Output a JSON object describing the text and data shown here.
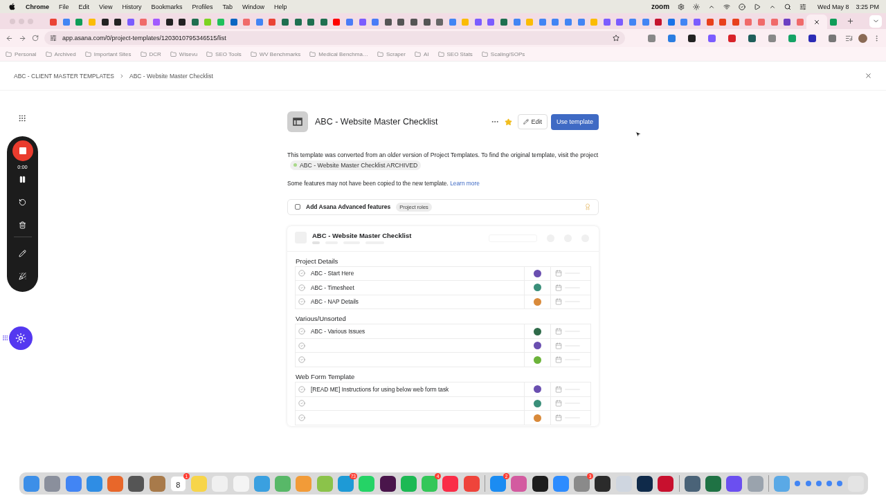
{
  "menubar": {
    "app": "Chrome",
    "menus": [
      "File",
      "Edit",
      "View",
      "History",
      "Bookmarks",
      "Profiles",
      "Tab",
      "Window",
      "Help"
    ],
    "zoom_label": "zoom",
    "date": "Wed May 8",
    "time": "3:25 PM"
  },
  "tabs": [
    {
      "color": "#ea4335",
      "selected": false
    },
    {
      "color": "#4285f4",
      "selected": false
    },
    {
      "color": "#0f9d58",
      "selected": false
    },
    {
      "color": "#fbbc04",
      "selected": false
    },
    {
      "color": "#222222",
      "selected": false
    },
    {
      "color": "#222222",
      "selected": false
    },
    {
      "color": "#7b5cff",
      "selected": false
    },
    {
      "color": "#f06a6a",
      "selected": false
    },
    {
      "color": "#a259ff",
      "selected": false
    },
    {
      "color": "#222222",
      "selected": false
    },
    {
      "color": "#222222",
      "selected": false
    },
    {
      "color": "#1f6f50",
      "selected": false
    },
    {
      "color": "#7dd321",
      "selected": false
    },
    {
      "color": "#20c05c",
      "selected": false
    },
    {
      "color": "#0a66c2",
      "selected": false
    },
    {
      "color": "#f06a6a",
      "selected": false
    },
    {
      "color": "#4285f4",
      "selected": false
    },
    {
      "color": "#ea4335",
      "selected": false
    },
    {
      "color": "#1f6f50",
      "selected": false
    },
    {
      "color": "#1f6f50",
      "selected": false
    },
    {
      "color": "#1f6f50",
      "selected": false
    },
    {
      "color": "#1f6f50",
      "selected": false
    },
    {
      "color": "#ff0000",
      "selected": false
    },
    {
      "color": "#4a7cf7",
      "selected": false
    },
    {
      "color": "#7b5cff",
      "selected": false
    },
    {
      "color": "#4a7cf7",
      "selected": false
    },
    {
      "color": "#555555",
      "selected": false
    },
    {
      "color": "#555555",
      "selected": false
    },
    {
      "color": "#555555",
      "selected": false
    },
    {
      "color": "#555555",
      "selected": false
    },
    {
      "color": "#666666",
      "selected": false
    },
    {
      "color": "#4285f4",
      "selected": false
    },
    {
      "color": "#fbbc04",
      "selected": false
    },
    {
      "color": "#7b5cff",
      "selected": false
    },
    {
      "color": "#7b5cff",
      "selected": false
    },
    {
      "color": "#1f6f50",
      "selected": false
    },
    {
      "color": "#4285f4",
      "selected": false
    },
    {
      "color": "#fbbc04",
      "selected": false
    },
    {
      "color": "#4285f4",
      "selected": false
    },
    {
      "color": "#4285f4",
      "selected": false
    },
    {
      "color": "#4285f4",
      "selected": false
    },
    {
      "color": "#4285f4",
      "selected": false
    },
    {
      "color": "#fbbc04",
      "selected": false
    },
    {
      "color": "#7b5cff",
      "selected": false
    },
    {
      "color": "#7b5cff",
      "selected": false
    },
    {
      "color": "#4285f4",
      "selected": false
    },
    {
      "color": "#4285f4",
      "selected": false
    },
    {
      "color": "#c4132d",
      "selected": false
    },
    {
      "color": "#1a73e8",
      "selected": false
    },
    {
      "color": "#4285f4",
      "selected": false
    },
    {
      "color": "#7b5cff",
      "selected": false
    },
    {
      "color": "#e8401c",
      "selected": false
    },
    {
      "color": "#e8401c",
      "selected": false
    },
    {
      "color": "#e8401c",
      "selected": false
    },
    {
      "color": "#f06a6a",
      "selected": false
    },
    {
      "color": "#f06a6a",
      "selected": false
    },
    {
      "color": "#f06a6a",
      "selected": false
    },
    {
      "color": "#6c3fc2",
      "selected": false
    },
    {
      "color": "#f06a6a",
      "selected": false
    },
    {
      "selected": true
    },
    {
      "color": "#0f9d58",
      "selected": false
    }
  ],
  "address_bar": {
    "url": "app.asana.com/0/project-templates/1203010795346515/list"
  },
  "extensions": [
    {
      "color": "#888888"
    },
    {
      "color": "#2a7de1"
    },
    {
      "color": "#222222"
    },
    {
      "color": "#7b5cff"
    },
    {
      "color": "#d8232a"
    },
    {
      "color": "#1f5f5b"
    },
    {
      "color": "#888888"
    },
    {
      "color": "#15a366"
    },
    {
      "color": "#2b2bb5"
    },
    {
      "color": "#777777"
    }
  ],
  "bookmarks": [
    "Personal",
    "Archived",
    "Important Sites",
    "DCR",
    "Wisevu",
    "SEO Tools",
    "WV Benchmarks",
    "Medical Benchma…",
    "Scraper",
    "AI",
    "SEO Stats",
    "Scaling/SOPs"
  ],
  "breadcrumb": [
    "ABC - CLIENT MASTER TEMPLATES",
    "ABC - Website Master Checklist"
  ],
  "recorder": {
    "time": "0:00"
  },
  "template": {
    "title": "ABC - Website Master Checklist",
    "starred": true,
    "edit_label": "Edit",
    "use_label": "Use template",
    "notice": "This template was converted from an older version of Project Templates. To find the original template, visit the project",
    "archived_project": "ABC - Website Master Checklist ARCHIVED",
    "features_note": "Some features may not have been copied to the new template.",
    "learn_more": "Learn more",
    "advanced": {
      "label": "Add Asana Advanced features",
      "checked": false,
      "tag": "Project roles"
    }
  },
  "preview": {
    "title": "ABC - Website Master Checklist",
    "sections": [
      {
        "name": "Project Details",
        "tasks": [
          {
            "name": "ABC - Start Here",
            "color": "#6a4fb0"
          },
          {
            "name": "ABC - Timesheet",
            "color": "#3a8f7a"
          },
          {
            "name": "ABC - NAP Details",
            "color": "#d98a3a"
          }
        ]
      },
      {
        "name": "Various/Unsorted",
        "tasks": [
          {
            "name": "ABC - Various Issues",
            "color": "#2f6b4a"
          },
          {
            "color": "#6a4fb0"
          },
          {
            "color": "#6cb33a"
          }
        ]
      },
      {
        "name": "Web Form Template",
        "tasks": [
          {
            "name": "[READ ME] Instructions for using below web form task",
            "color": "#6a4fb0"
          },
          {
            "color": "#3a8f7a"
          },
          {
            "color": "#d98a3a"
          }
        ]
      }
    ]
  },
  "dock": [
    {
      "kind": "app",
      "color": "#3d8fe8"
    },
    {
      "kind": "app",
      "color": "#8a8f9c"
    },
    {
      "kind": "app",
      "color": "#4285f4"
    },
    {
      "kind": "app",
      "color": "#2f8de4"
    },
    {
      "kind": "app",
      "color": "#e8672a"
    },
    {
      "kind": "app",
      "color": "#555555"
    },
    {
      "kind": "app",
      "color": "#a87a4a"
    },
    {
      "kind": "app",
      "color": "#ffffff",
      "label": "8",
      "badge": "1"
    },
    {
      "kind": "app",
      "color": "#f7d54a"
    },
    {
      "kind": "app",
      "color": "#f0f0f0"
    },
    {
      "kind": "app",
      "color": "#f4f4f4"
    },
    {
      "kind": "app",
      "color": "#3aa0e0"
    },
    {
      "kind": "app",
      "color": "#58b868"
    },
    {
      "kind": "app",
      "color": "#f29b38"
    },
    {
      "kind": "app",
      "color": "#8bc34a"
    },
    {
      "kind": "app",
      "color": "#1e9ad6",
      "badge": "73"
    },
    {
      "kind": "app",
      "color": "#25d366"
    },
    {
      "kind": "app",
      "color": "#4a154b"
    },
    {
      "kind": "app",
      "color": "#1db954"
    },
    {
      "kind": "app",
      "color": "#34c759",
      "badge": "4"
    },
    {
      "kind": "app",
      "color": "#fa2d48"
    },
    {
      "kind": "app",
      "color": "#ef443b"
    },
    {
      "kind": "divider"
    },
    {
      "kind": "app",
      "color": "#1b8cf2",
      "badge": "2"
    },
    {
      "kind": "app",
      "color": "#d35ba0"
    },
    {
      "kind": "app",
      "color": "#1d1d1d"
    },
    {
      "kind": "app",
      "color": "#2d8cff"
    },
    {
      "kind": "app",
      "color": "#8a8a8a",
      "badge": "3"
    },
    {
      "kind": "app",
      "color": "#2b2b2b"
    },
    {
      "kind": "app",
      "color": "#cfd6e0"
    },
    {
      "kind": "app",
      "color": "#0f2a4a"
    },
    {
      "kind": "app",
      "color": "#c8102e"
    },
    {
      "kind": "divider"
    },
    {
      "kind": "app",
      "color": "#4a6378"
    },
    {
      "kind": "app",
      "color": "#1f7244"
    },
    {
      "kind": "app",
      "color": "#6b4ff0"
    },
    {
      "kind": "app",
      "color": "#9aa3ad"
    },
    {
      "kind": "divider"
    },
    {
      "kind": "app",
      "color": "#5aa9e6"
    },
    {
      "kind": "window",
      "color": "#4285f4"
    },
    {
      "kind": "window",
      "color": "#4285f4"
    },
    {
      "kind": "window",
      "color": "#4285f4"
    },
    {
      "kind": "window",
      "color": "#4285f4"
    },
    {
      "kind": "window",
      "color": "#4285f4"
    },
    {
      "kind": "app",
      "color": "#e4e4e4"
    }
  ]
}
